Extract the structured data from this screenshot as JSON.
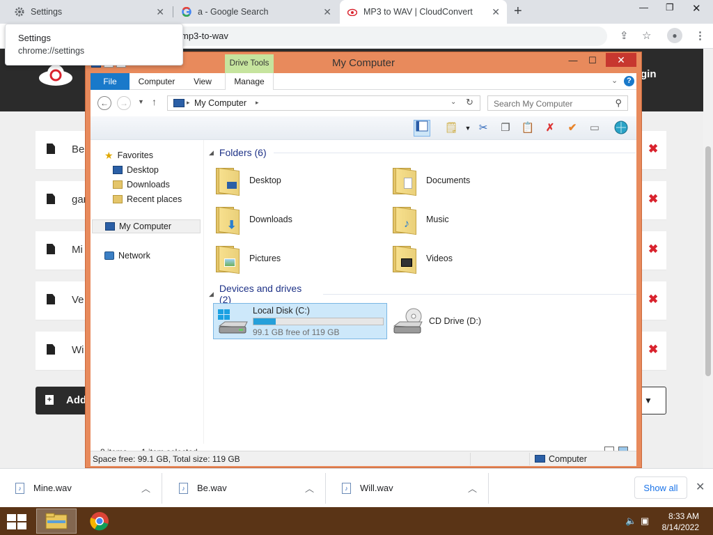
{
  "browser": {
    "tabs": [
      {
        "title": "Settings"
      },
      {
        "title": "a - Google Search"
      },
      {
        "title": "MP3 to WAV | CloudConvert"
      }
    ],
    "url_fragment": "mp3-to-wav",
    "tooltip": {
      "title": "Settings",
      "url": "chrome://settings"
    }
  },
  "page": {
    "login": "gin",
    "files": [
      {
        "name": "Be"
      },
      {
        "name": "gar"
      },
      {
        "name": "Mi"
      },
      {
        "name": "Ve"
      },
      {
        "name": "Wi"
      }
    ],
    "add_label": "Add"
  },
  "explorer": {
    "title": "My Computer",
    "drive_tools": "Drive Tools",
    "ribbon_tabs": [
      "File",
      "Computer",
      "View",
      "Manage"
    ],
    "address": "My Computer",
    "search_placeholder": "Search My Computer",
    "nav": {
      "favorites": "Favorites",
      "desktop": "Desktop",
      "downloads": "Downloads",
      "recent": "Recent places",
      "computer": "My Computer",
      "network": "Network"
    },
    "folders_header": "Folders (6)",
    "folders": [
      "Desktop",
      "Documents",
      "Downloads",
      "Music",
      "Pictures",
      "Videos"
    ],
    "devices_header": "Devices and drives (2)",
    "drive_c": {
      "name": "Local Disk (C:)",
      "free": "99.1 GB free of 119 GB",
      "used_fraction": 0.17
    },
    "drive_d": {
      "name": "CD Drive (D:)"
    },
    "status_items": "8 items",
    "status_selected": "1 item selected",
    "info_space": "Space free: 99.1 GB, Total size: 119 GB",
    "info_location": "Computer"
  },
  "downloads": {
    "items": [
      {
        "name": "Mine.wav"
      },
      {
        "name": "Be.wav"
      },
      {
        "name": "Will.wav"
      }
    ],
    "show_all": "Show all"
  },
  "taskbar": {
    "time": "8:33 AM",
    "date": "8/14/2022"
  },
  "colors": {
    "explorer_frame": "#e88a5c",
    "taskbar": "#5a3416",
    "accent": "#1979ca",
    "delete_red": "#d9232e"
  }
}
